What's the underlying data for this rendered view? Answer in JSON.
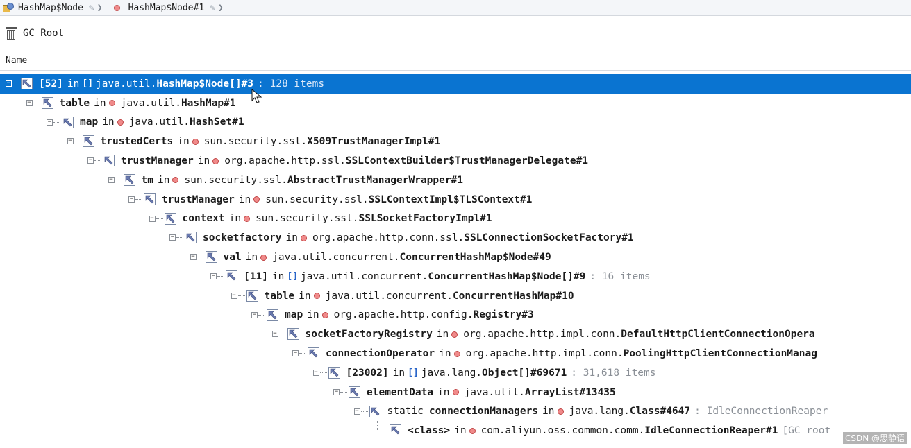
{
  "breadcrumb": {
    "items": [
      {
        "label": "HashMap$Node",
        "icon": "class-icon"
      },
      {
        "label": "HashMap$Node#1",
        "icon": "instance-dot-icon"
      }
    ]
  },
  "toolbar": {
    "gc_root_label": "GC Root"
  },
  "column": {
    "name_label": "Name"
  },
  "colors": {
    "selection": "#0a74d1",
    "instance_dot": "#f08a8a",
    "array_icon": "#2a66c9"
  },
  "tree": [
    {
      "depth": 0,
      "toggle": "−",
      "field": "[52]",
      "static": "",
      "kind": "array",
      "pkg": "java.util.",
      "cls": "HashMap$Node[]#3",
      "meta": ": 128 items",
      "selected": true
    },
    {
      "depth": 1,
      "toggle": "−",
      "field": "table",
      "static": "",
      "kind": "object",
      "pkg": "java.util.",
      "cls": "HashMap#1",
      "meta": ""
    },
    {
      "depth": 2,
      "toggle": "−",
      "field": "map",
      "static": "",
      "kind": "object",
      "pkg": "java.util.",
      "cls": "HashSet#1",
      "meta": ""
    },
    {
      "depth": 3,
      "toggle": "−",
      "field": "trustedCerts",
      "static": "",
      "kind": "object",
      "pkg": "sun.security.ssl.",
      "cls": "X509TrustManagerImpl#1",
      "meta": ""
    },
    {
      "depth": 4,
      "toggle": "−",
      "field": "trustManager",
      "static": "",
      "kind": "object",
      "pkg": "org.apache.http.ssl.",
      "cls": "SSLContextBuilder$TrustManagerDelegate#1",
      "meta": ""
    },
    {
      "depth": 5,
      "toggle": "−",
      "field": "tm",
      "static": "",
      "kind": "object",
      "pkg": "sun.security.ssl.",
      "cls": "AbstractTrustManagerWrapper#1",
      "meta": ""
    },
    {
      "depth": 6,
      "toggle": "−",
      "field": "trustManager",
      "static": "",
      "kind": "object",
      "pkg": "sun.security.ssl.",
      "cls": "SSLContextImpl$TLSContext#1",
      "meta": ""
    },
    {
      "depth": 7,
      "toggle": "−",
      "field": "context",
      "static": "",
      "kind": "object",
      "pkg": "sun.security.ssl.",
      "cls": "SSLSocketFactoryImpl#1",
      "meta": ""
    },
    {
      "depth": 8,
      "toggle": "−",
      "field": "socketfactory",
      "static": "",
      "kind": "object",
      "pkg": "org.apache.http.conn.ssl.",
      "cls": "SSLConnectionSocketFactory#1",
      "meta": ""
    },
    {
      "depth": 9,
      "toggle": "−",
      "field": "val",
      "static": "",
      "kind": "object",
      "pkg": "java.util.concurrent.",
      "cls": "ConcurrentHashMap$Node#49",
      "meta": ""
    },
    {
      "depth": 10,
      "toggle": "−",
      "field": "[11]",
      "static": "",
      "kind": "array",
      "pkg": "java.util.concurrent.",
      "cls": "ConcurrentHashMap$Node[]#9",
      "meta": ": 16 items"
    },
    {
      "depth": 11,
      "toggle": "−",
      "field": "table",
      "static": "",
      "kind": "object",
      "pkg": "java.util.concurrent.",
      "cls": "ConcurrentHashMap#10",
      "meta": ""
    },
    {
      "depth": 12,
      "toggle": "−",
      "field": "map",
      "static": "",
      "kind": "object",
      "pkg": "org.apache.http.config.",
      "cls": "Registry#3",
      "meta": ""
    },
    {
      "depth": 13,
      "toggle": "−",
      "field": "socketFactoryRegistry",
      "static": "",
      "kind": "object",
      "pkg": "org.apache.http.impl.conn.",
      "cls": "DefaultHttpClientConnectionOpera",
      "meta": ""
    },
    {
      "depth": 14,
      "toggle": "−",
      "field": "connectionOperator",
      "static": "",
      "kind": "object",
      "pkg": "org.apache.http.impl.conn.",
      "cls": "PoolingHttpClientConnectionManag",
      "meta": ""
    },
    {
      "depth": 15,
      "toggle": "−",
      "field": "[23002]",
      "static": "",
      "kind": "array",
      "pkg": "java.lang.",
      "cls": "Object[]#69671",
      "meta": ": 31,618 items"
    },
    {
      "depth": 16,
      "toggle": "−",
      "field": "elementData",
      "static": "",
      "kind": "object",
      "pkg": "java.util.",
      "cls": "ArrayList#13435",
      "meta": ""
    },
    {
      "depth": 17,
      "toggle": "−",
      "field": "connectionManagers",
      "static": "static",
      "kind": "object",
      "pkg": "java.lang.",
      "cls": "Class#4647",
      "meta": ": IdleConnectionReaper"
    },
    {
      "depth": 18,
      "toggle": "",
      "field": "<class>",
      "static": "",
      "kind": "object",
      "pkg": "com.aliyun.oss.common.comm.",
      "cls": "IdleConnectionReaper#1",
      "meta": "[GC root"
    }
  ],
  "in_label": "in",
  "watermark": "CSDN @思静语"
}
